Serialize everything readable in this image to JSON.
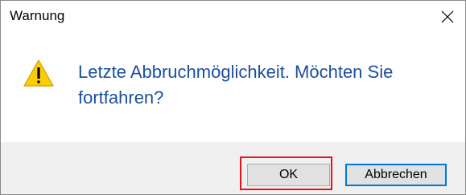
{
  "window": {
    "title": "Warnung",
    "close_icon": "close-icon"
  },
  "message": {
    "icon": "warning-icon",
    "text": "Letzte Abbruchmöglichkeit. Möchten Sie fortfahren?"
  },
  "buttons": {
    "ok_label": "OK",
    "cancel_label": "Abbrechen"
  },
  "colors": {
    "message_text": "#1b4f9c",
    "highlight": "#e3141e",
    "default_button_border": "#0078d7",
    "warning_fill": "#ffcc00"
  }
}
